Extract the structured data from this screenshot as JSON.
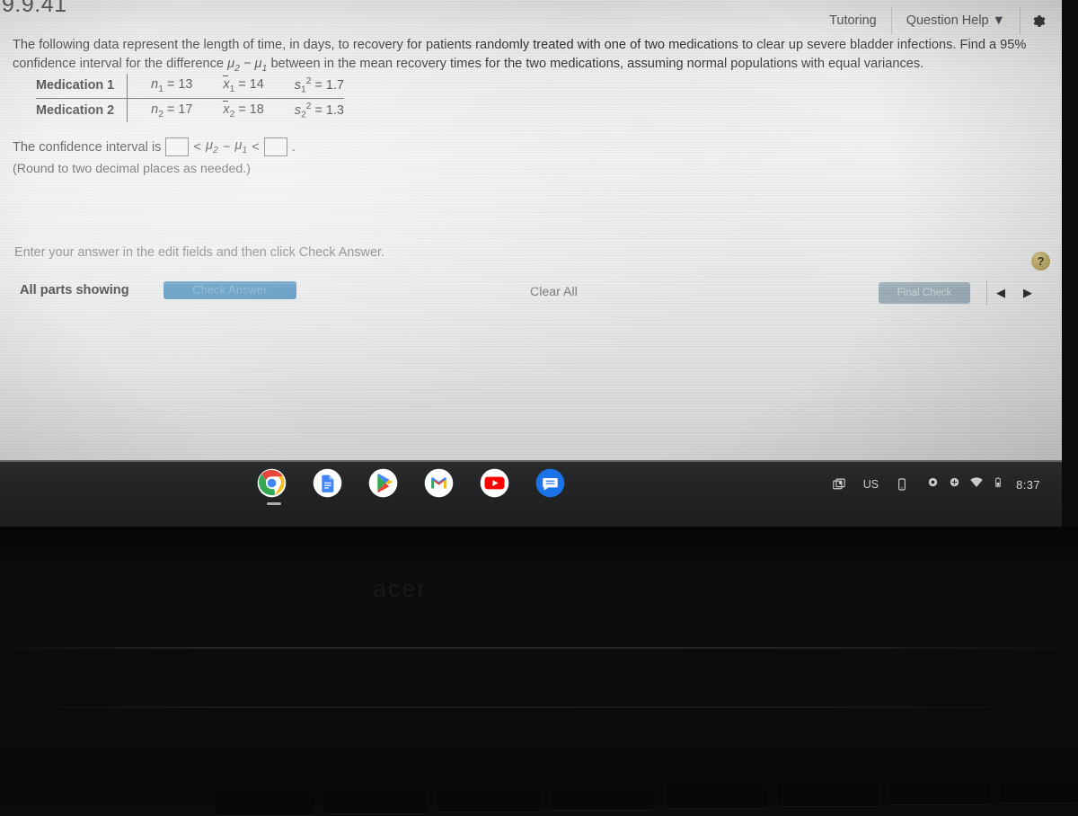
{
  "window": {
    "clipped_header": "9.9.41"
  },
  "toolbar": {
    "tutoring_label": "Tutoring",
    "question_help_label": "Question Help",
    "question_help_caret": "▼",
    "gear_icon": "gear-icon"
  },
  "question": {
    "paragraph_part1": "The following data represent the length of time, in days, to recovery for patients randomly treated with one of two medications to clear up severe bladder infections. Find a 95% confidence interval for the difference ",
    "mu2": "μ",
    "mu2_sub": "2",
    "minus": " − ",
    "mu1": "μ",
    "mu1_sub": "1",
    "paragraph_part2": " between in the mean recovery times for the two medications, assuming normal populations with equal variances."
  },
  "stats_table": {
    "rows": [
      {
        "label": "Medication 1",
        "n_symbol": "n",
        "n_sub": "1",
        "n_value": "= 13",
        "xbar_symbol": "x",
        "xbar_sub": "1",
        "xbar_value": "= 14",
        "s_symbol": "s",
        "s_sub": "1",
        "s_sup": "2",
        "s_value": "= 1.7"
      },
      {
        "label": "Medication 2",
        "n_symbol": "n",
        "n_sub": "2",
        "n_value": "= 17",
        "xbar_symbol": "x",
        "xbar_sub": "2",
        "xbar_value": "= 18",
        "s_symbol": "s",
        "s_sub": "2",
        "s_sup": "2",
        "s_value": "= 1.3"
      }
    ]
  },
  "answer": {
    "prompt": "The confidence interval is",
    "lower_value": "",
    "inequality_left": "<",
    "mu2": "μ",
    "mu2_sub": "2",
    "minus": "−",
    "mu1": "μ",
    "mu1_sub": "1",
    "inequality_right": "<",
    "upper_value": "",
    "period": ".",
    "round_note": "(Round to two decimal places as needed.)"
  },
  "footer": {
    "instruction": "Enter your answer in the edit fields and then click Check Answer.",
    "all_parts_label": "All parts showing",
    "check_answer_label": "Check Answer",
    "clear_all_label": "Clear All",
    "final_check_label": "Final Check",
    "prev_arrow": "◀",
    "next_arrow": "▶",
    "help_icon_label": "?"
  },
  "shelf": {
    "apps": [
      {
        "name": "chrome-icon",
        "label": "Chrome"
      },
      {
        "name": "google-docs-icon",
        "label": "Docs"
      },
      {
        "name": "play-store-icon",
        "label": "Play Store"
      },
      {
        "name": "gmail-icon",
        "label": "Gmail"
      },
      {
        "name": "youtube-icon",
        "label": "YouTube"
      },
      {
        "name": "messages-icon",
        "label": "Messages"
      }
    ],
    "tray": {
      "screen-capture_icon": "screen-capture-icon",
      "keyboard_layout": "US",
      "phone_hub_icon": "phone-icon",
      "accessibility_icon": "circle-icon",
      "night-light_icon": "circle-plus-icon",
      "wifi_icon": "wifi-icon",
      "battery_icon": "battery-icon",
      "clock": "8:37"
    }
  },
  "colors": {
    "check_button_blue": "#3b86ba",
    "final_check_gray": "#8aa1ae",
    "help_icon_gold": "#b8a45e",
    "shelf_dark": "#232426"
  }
}
